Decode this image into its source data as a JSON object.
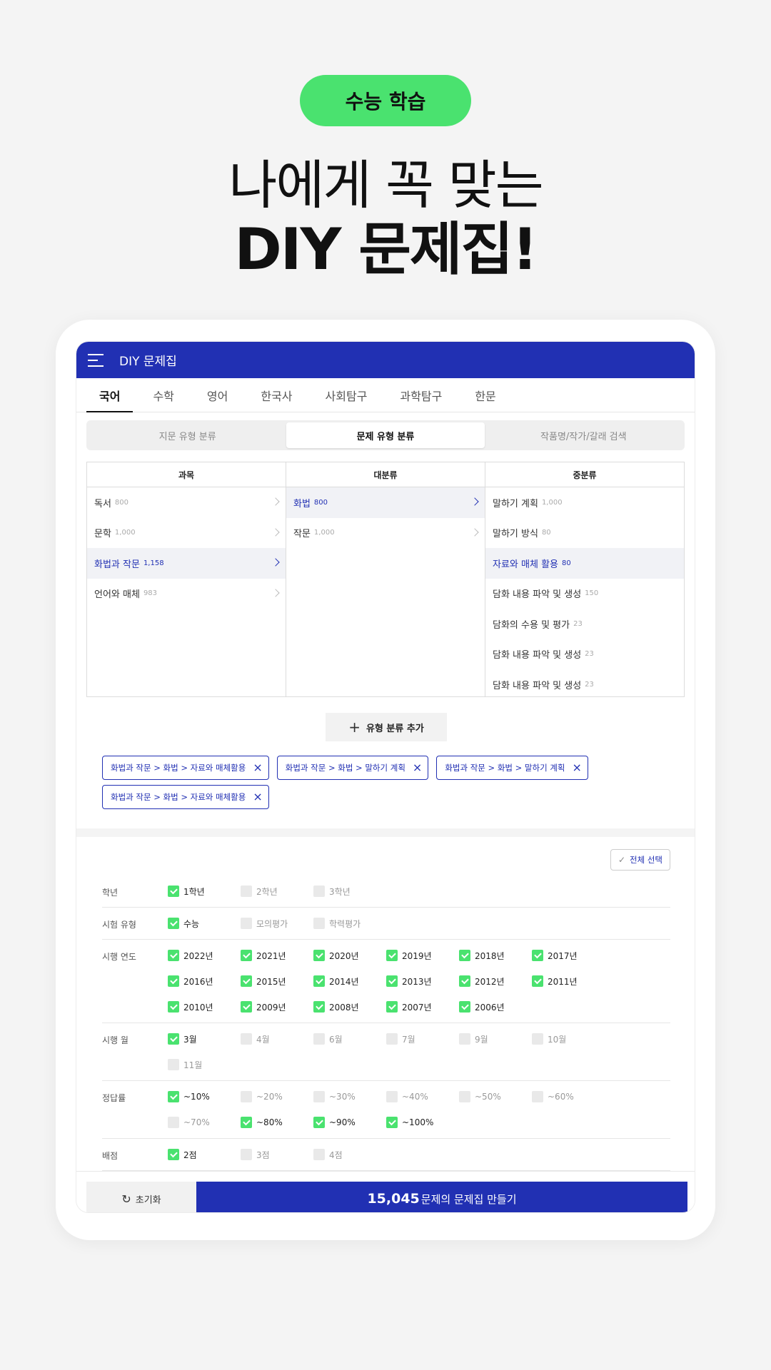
{
  "promo": {
    "pill_label": "수능 학습",
    "headline_line1": "나에게 꼭 맞는",
    "headline_line2": "DIY 문제집!"
  },
  "appbar": {
    "title": "DIY 문제집"
  },
  "tabs": [
    "국어",
    "수학",
    "영어",
    "한국사",
    "사회탐구",
    "과학탐구",
    "한문"
  ],
  "active_tab": "국어",
  "segments": [
    "지문 유형 분류",
    "문제 유형 분류",
    "작품명/작가/갈래 검색"
  ],
  "active_segment": "문제 유형 분류",
  "columns": {
    "subject": {
      "header": "과목",
      "items": [
        {
          "label": "독서",
          "count": "800"
        },
        {
          "label": "문학",
          "count": "1,000"
        },
        {
          "label": "화법과 작문",
          "count": "1,158"
        },
        {
          "label": "언어와 매체",
          "count": "983"
        }
      ]
    },
    "major": {
      "header": "대분류",
      "items": [
        {
          "label": "화법",
          "count": "800"
        },
        {
          "label": "작문",
          "count": "1,000"
        }
      ]
    },
    "middle": {
      "header": "중분류",
      "items": [
        {
          "label": "말하기 계획",
          "count": "1,000"
        },
        {
          "label": "말하기 방식",
          "count": "80"
        },
        {
          "label": "자료와 매체 활용",
          "count": "80"
        },
        {
          "label": "담화 내용 파악 및 생성",
          "count": "150"
        },
        {
          "label": "담화의 수용 및 평가",
          "count": "23"
        },
        {
          "label": "담화 내용 파악 및 생성",
          "count": "23"
        },
        {
          "label": "담화 내용 파악 및 생성",
          "count": "23"
        }
      ]
    }
  },
  "add_type_button": "유형 분류 추가",
  "chips": [
    "화법과 작문 > 화법 > 자료와 매체활용",
    "화법과 작문 > 화법 > 말하기 계획",
    "화법과 작문 > 화법 > 말하기 계획",
    "화법과 작문 > 화법 > 자료와 매체활용"
  ],
  "select_all": "전체 선택",
  "filters": {
    "grade": {
      "label": "학년",
      "options": [
        {
          "text": "1학년",
          "checked": true
        },
        {
          "text": "2학년",
          "checked": false
        },
        {
          "text": "3학년",
          "checked": false
        }
      ]
    },
    "exam_type": {
      "label": "시험 유형",
      "options": [
        {
          "text": "수능",
          "checked": true
        },
        {
          "text": "모의평가",
          "checked": false
        },
        {
          "text": "학력평가",
          "checked": false
        }
      ]
    },
    "exam_year": {
      "label": "시행 연도",
      "options": [
        {
          "text": "2022년",
          "checked": true
        },
        {
          "text": "2021년",
          "checked": true
        },
        {
          "text": "2020년",
          "checked": true
        },
        {
          "text": "2019년",
          "checked": true
        },
        {
          "text": "2018년",
          "checked": true
        },
        {
          "text": "2017년",
          "checked": true
        },
        {
          "text": "2016년",
          "checked": true
        },
        {
          "text": "2015년",
          "checked": true
        },
        {
          "text": "2014년",
          "checked": true
        },
        {
          "text": "2013년",
          "checked": true
        },
        {
          "text": "2012년",
          "checked": true
        },
        {
          "text": "2011년",
          "checked": true
        },
        {
          "text": "2010년",
          "checked": true
        },
        {
          "text": "2009년",
          "checked": true
        },
        {
          "text": "2008년",
          "checked": true
        },
        {
          "text": "2007년",
          "checked": true
        },
        {
          "text": "2006년",
          "checked": true
        }
      ]
    },
    "exam_month": {
      "label": "시행 월",
      "options": [
        {
          "text": "3월",
          "checked": true
        },
        {
          "text": "4월",
          "checked": false
        },
        {
          "text": "6월",
          "checked": false
        },
        {
          "text": "7월",
          "checked": false
        },
        {
          "text": "9월",
          "checked": false
        },
        {
          "text": "10월",
          "checked": false
        },
        {
          "text": "11월",
          "checked": false
        }
      ]
    },
    "accuracy": {
      "label": "정답률",
      "options": [
        {
          "text": "~10%",
          "checked": true
        },
        {
          "text": "~20%",
          "checked": false
        },
        {
          "text": "~30%",
          "checked": false
        },
        {
          "text": "~40%",
          "checked": false
        },
        {
          "text": "~50%",
          "checked": false
        },
        {
          "text": "~60%",
          "checked": false
        },
        {
          "text": "~70%",
          "checked": false
        },
        {
          "text": "~80%",
          "checked": true
        },
        {
          "text": "~90%",
          "checked": true
        },
        {
          "text": "~100%",
          "checked": true
        }
      ]
    },
    "points": {
      "label": "배점",
      "options": [
        {
          "text": "2점",
          "checked": true
        },
        {
          "text": "3점",
          "checked": false
        },
        {
          "text": "4점",
          "checked": false
        }
      ]
    }
  },
  "bottom": {
    "reset_label": "초기화",
    "make_count": "15,045",
    "make_label": "문제의 문제집 만들기"
  },
  "colors": {
    "brand_blue": "#2130b3",
    "accent_green": "#4ae26f"
  }
}
